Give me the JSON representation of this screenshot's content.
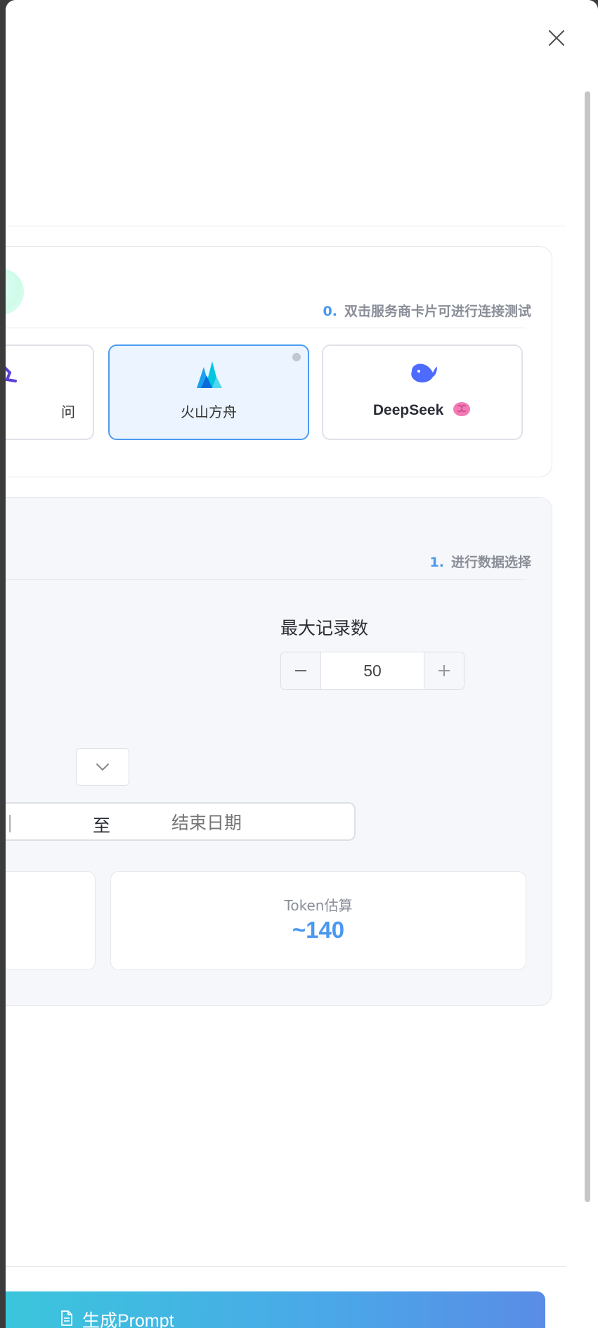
{
  "header": {
    "close_icon": "close-icon"
  },
  "provider_section": {
    "hint_number": "0.",
    "hint_text": "双击服务商卡片可进行连接测试",
    "providers": [
      {
        "label": "千问",
        "visible_label": "千问",
        "icon": "qwen-logo-icon",
        "selected": false
      },
      {
        "label": "火山方舟",
        "icon": "volcano-ark-logo-icon",
        "selected": true,
        "status_color": "#c2c6cf"
      },
      {
        "label": "DeepSeek",
        "icon": "deepseek-whale-icon",
        "badge_icon": "brain-icon",
        "selected": false
      }
    ]
  },
  "data_section": {
    "hint_number": "1.",
    "hint_text": "进行数据选择",
    "max_records": {
      "label": "最大记录数",
      "value": "50"
    },
    "dropdown_icon": "chevron-down-icon",
    "date_range": {
      "separator": "至",
      "end_placeholder": "结束日期"
    },
    "token_estimate": {
      "title": "Token估算",
      "value": "~140"
    }
  },
  "footer": {
    "generate_label": "生成Prompt",
    "generate_icon": "document-icon"
  },
  "colors": {
    "accent": "#4a98f0",
    "selected_tile_bg": "#ebf4ff",
    "selected_tile_border": "#4b9cf0",
    "button_gradient_start": "#3ac7dc",
    "button_gradient_end": "#5a8ce6"
  }
}
